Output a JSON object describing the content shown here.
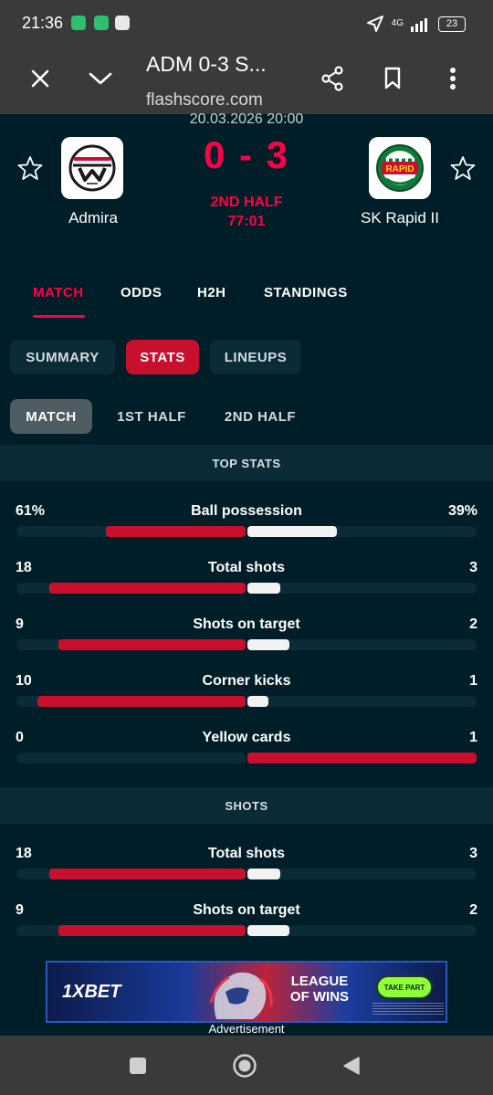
{
  "status_bar": {
    "time": "21:36",
    "network": "4G",
    "battery": "23",
    "icons": [
      "shield-app-icon",
      "swap-app-icon",
      "sabas-app-icon",
      "location-icon",
      "signal-icon",
      "battery-icon"
    ]
  },
  "browser": {
    "title": "ADM 0-3 S...",
    "url": "flashscore.com",
    "icons": [
      "close-icon",
      "chevron-down-icon",
      "share-icon",
      "bookmark-icon",
      "more-vert-icon"
    ]
  },
  "match": {
    "datetime": "20.03.2026 20:00",
    "home": {
      "name": "Admira"
    },
    "away": {
      "name": "SK Rapid II",
      "logo_text": "RAPID"
    },
    "score": "0 - 3",
    "phase": "2ND HALF",
    "clock": "77:01"
  },
  "main_tabs": [
    "MATCH",
    "ODDS",
    "H2H",
    "STANDINGS"
  ],
  "sub_tabs": [
    "SUMMARY",
    "STATS",
    "LINEUPS"
  ],
  "period_tabs": [
    "MATCH",
    "1ST HALF",
    "2ND HALF"
  ],
  "sections": [
    {
      "title": "TOP STATS",
      "stats": [
        {
          "label": "Ball possession",
          "home": "61%",
          "away": "39%",
          "home_value": 61,
          "away_value": 39
        },
        {
          "label": "Total shots",
          "home": "18",
          "away": "3",
          "home_value": 18,
          "away_value": 3
        },
        {
          "label": "Shots on target",
          "home": "9",
          "away": "2",
          "home_value": 9,
          "away_value": 2
        },
        {
          "label": "Corner kicks",
          "home": "10",
          "away": "1",
          "home_value": 10,
          "away_value": 1
        },
        {
          "label": "Yellow cards",
          "home": "0",
          "away": "1",
          "home_value": 0,
          "away_value": 1
        }
      ]
    },
    {
      "title": "SHOTS",
      "stats": [
        {
          "label": "Total shots",
          "home": "18",
          "away": "3",
          "home_value": 18,
          "away_value": 3
        },
        {
          "label": "Shots on target",
          "home": "9",
          "away": "2",
          "home_value": 9,
          "away_value": 2
        }
      ]
    }
  ],
  "ad": {
    "brand": "1XBET",
    "slogan": "LEAGUE OF WINS",
    "cta": "TAKE PART",
    "label": "Advertisement"
  },
  "colors": {
    "background": "#001e28",
    "accent": "#ff0046",
    "home_bar": "#c8102e",
    "away_bar": "#f2f2f2",
    "chrome": "#3a3a3a"
  }
}
